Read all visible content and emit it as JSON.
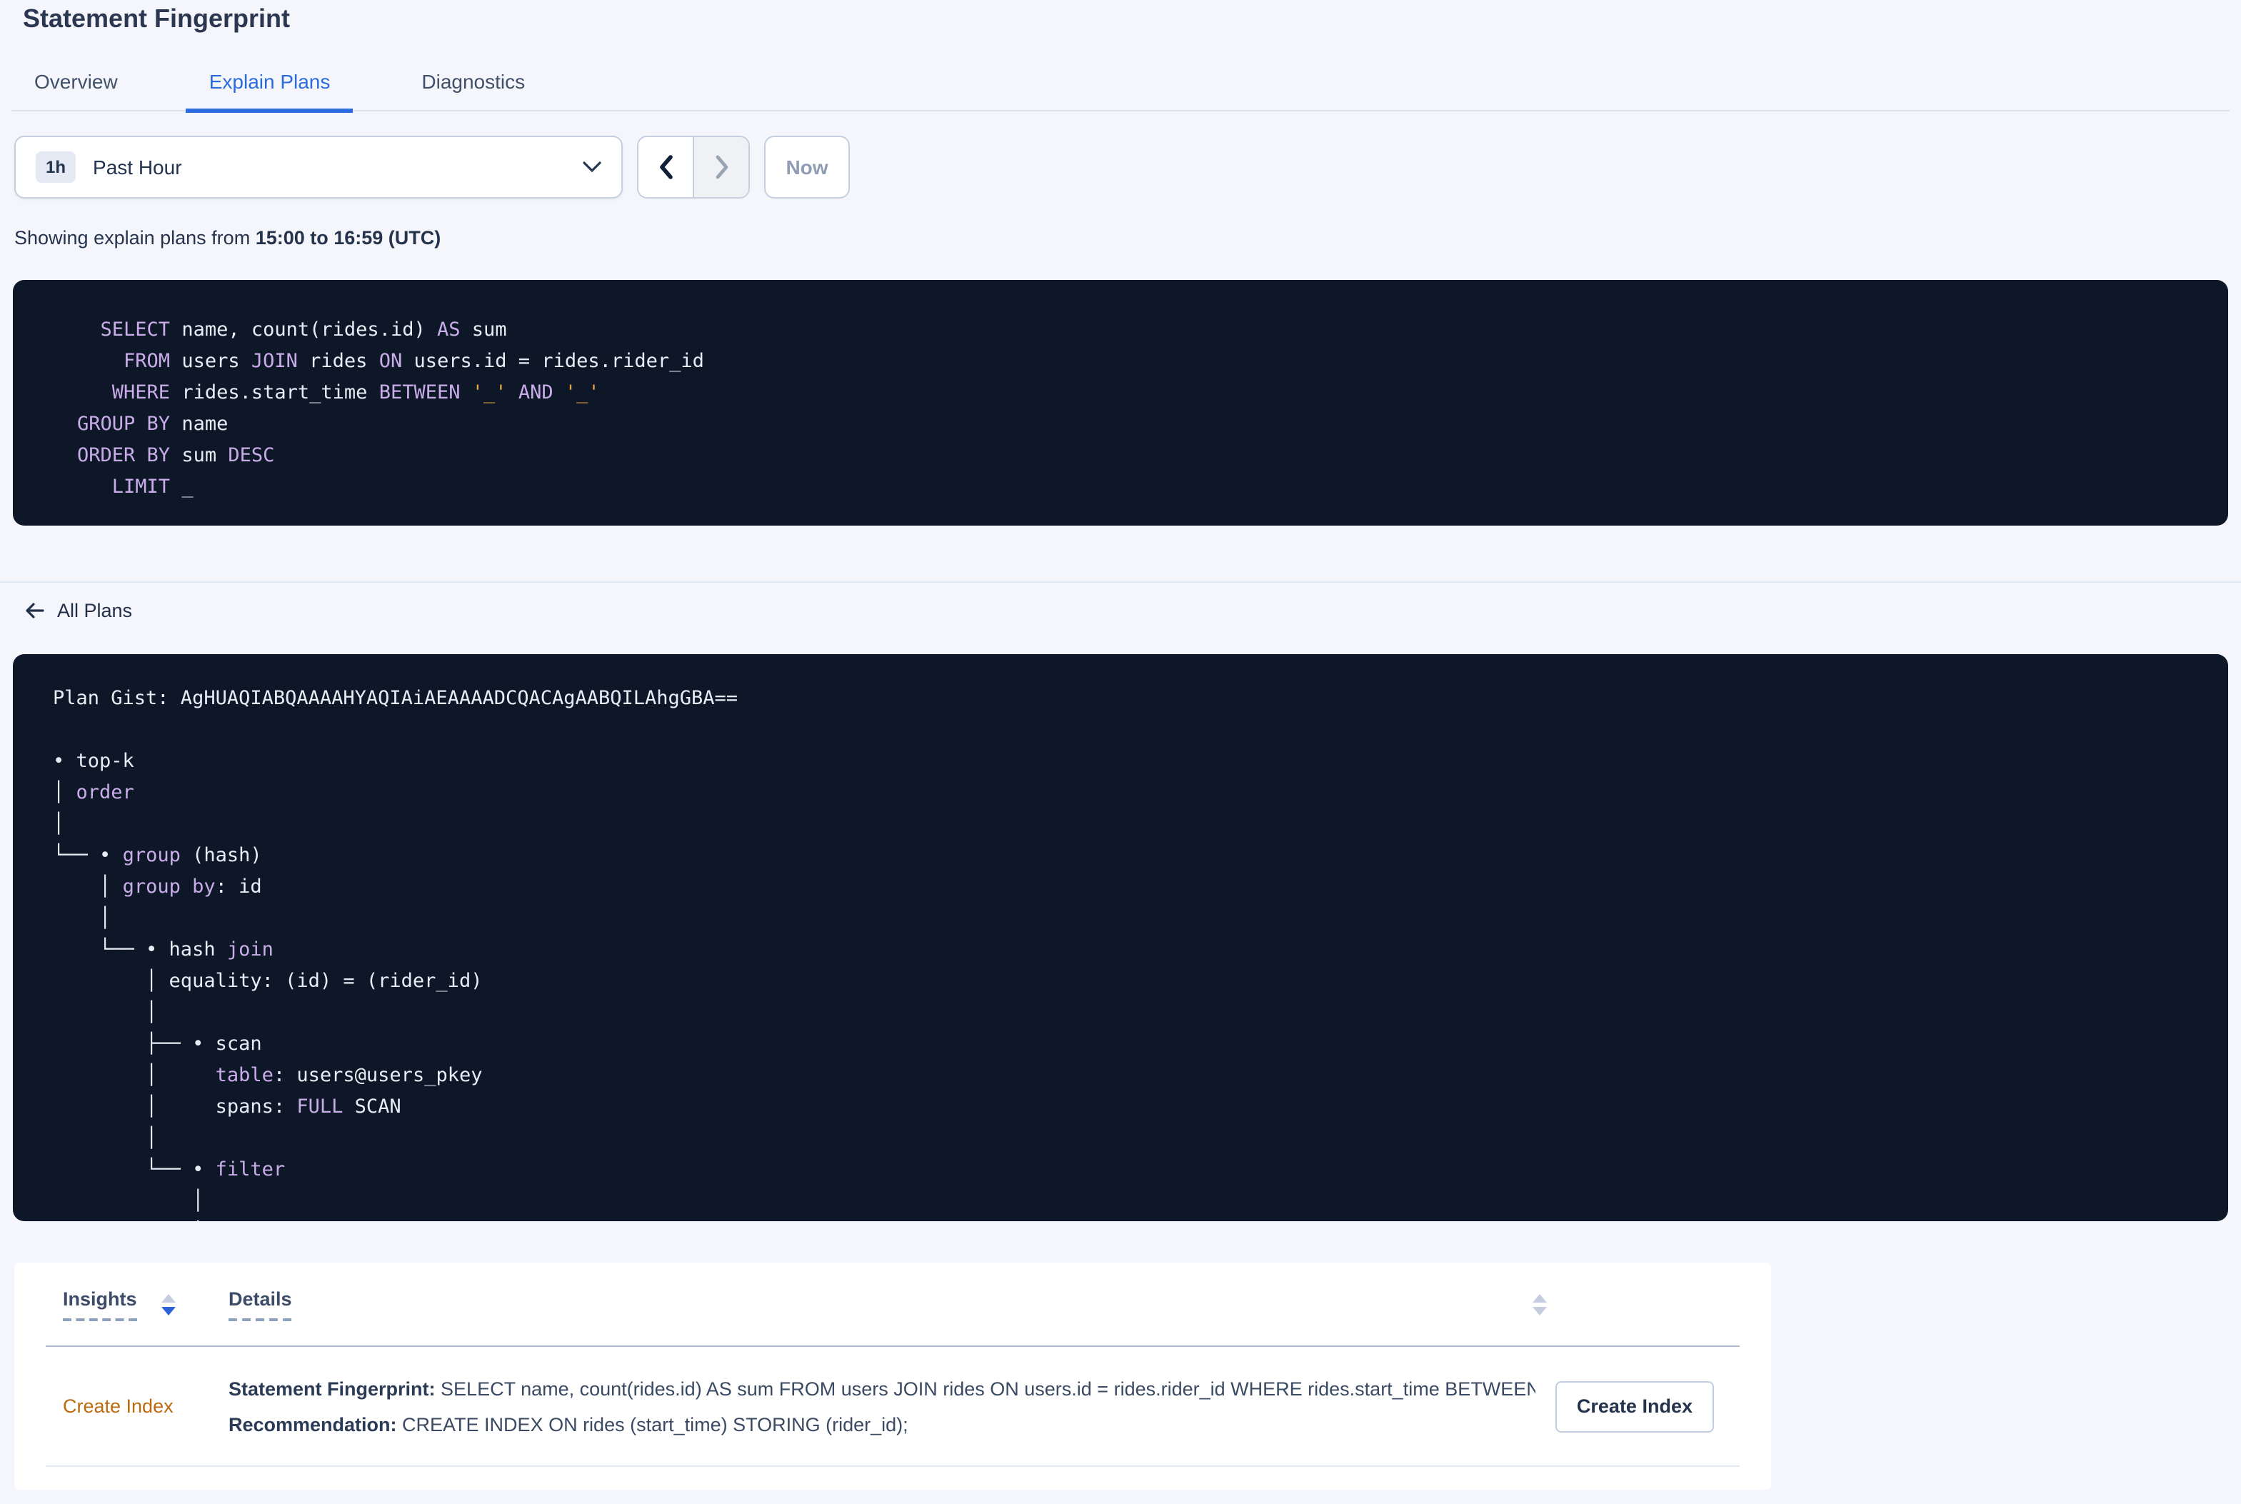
{
  "header": {
    "title": "Statement Fingerprint"
  },
  "tabs": [
    {
      "label": "Overview"
    },
    {
      "label": "Explain Plans"
    },
    {
      "label": "Diagnostics"
    }
  ],
  "time_picker": {
    "badge": "1h",
    "selected": "Past Hour",
    "now": "Now"
  },
  "subtitle": {
    "prefix": "Showing explain plans from ",
    "range": "15:00 to 16:59 (UTC)"
  },
  "sql_code": [
    [
      [
        "p",
        "  "
      ],
      [
        "k",
        "SELECT"
      ],
      [
        "p",
        " name, count(rides.id) "
      ],
      [
        "k",
        "AS"
      ],
      [
        "p",
        " sum"
      ]
    ],
    [
      [
        "p",
        "    "
      ],
      [
        "k",
        "FROM"
      ],
      [
        "p",
        " users "
      ],
      [
        "k",
        "JOIN"
      ],
      [
        "p",
        " rides "
      ],
      [
        "k",
        "ON"
      ],
      [
        "p",
        " users.id = rides.rider_id"
      ]
    ],
    [
      [
        "p",
        "   "
      ],
      [
        "k",
        "WHERE"
      ],
      [
        "p",
        " rides.start_time "
      ],
      [
        "k",
        "BETWEEN"
      ],
      [
        "p",
        " "
      ],
      [
        "l",
        "'_'"
      ],
      [
        "p",
        " "
      ],
      [
        "k",
        "AND"
      ],
      [
        "p",
        " "
      ],
      [
        "l",
        "'_'"
      ]
    ],
    [
      [
        "k",
        "GROUP BY"
      ],
      [
        "p",
        " name"
      ]
    ],
    [
      [
        "k",
        "ORDER BY"
      ],
      [
        "p",
        " sum "
      ],
      [
        "k",
        "DESC"
      ]
    ],
    [
      [
        "p",
        "   "
      ],
      [
        "k",
        "LIMIT"
      ],
      [
        "p",
        " _"
      ]
    ]
  ],
  "plans_nav": {
    "back_label": "All Plans"
  },
  "plan_code": [
    [
      [
        "p",
        "Plan Gist: AgHUAQIABQAAAAHYAQIAiAEAAAADCQACAgAABQILAhgGBA=="
      ]
    ],
    [],
    [
      [
        "p",
        "• top-k"
      ]
    ],
    [
      [
        "p",
        "│ "
      ],
      [
        "k",
        "order"
      ]
    ],
    [
      [
        "p",
        "│"
      ]
    ],
    [
      [
        "p",
        "└── • "
      ],
      [
        "k",
        "group"
      ],
      [
        "p",
        " (hash)"
      ]
    ],
    [
      [
        "p",
        "    │ "
      ],
      [
        "k",
        "group by"
      ],
      [
        "p",
        ": id"
      ]
    ],
    [
      [
        "p",
        "    │"
      ]
    ],
    [
      [
        "p",
        "    └── • hash "
      ],
      [
        "k",
        "join"
      ]
    ],
    [
      [
        "p",
        "        │ equality: (id) = (rider_id)"
      ]
    ],
    [
      [
        "p",
        "        │"
      ]
    ],
    [
      [
        "p",
        "        ├── • scan"
      ]
    ],
    [
      [
        "p",
        "        │     "
      ],
      [
        "k",
        "table"
      ],
      [
        "p",
        ": users@users_pkey"
      ]
    ],
    [
      [
        "p",
        "        │     spans: "
      ],
      [
        "k",
        "FULL"
      ],
      [
        "p",
        " SCAN"
      ]
    ],
    [
      [
        "p",
        "        │"
      ]
    ],
    [
      [
        "p",
        "        └── • "
      ],
      [
        "k",
        "filter"
      ]
    ],
    [
      [
        "p",
        "            │"
      ]
    ],
    [
      [
        "p",
        "            │"
      ]
    ]
  ],
  "insights": {
    "col_insights": "Insights",
    "col_details": "Details",
    "rows": [
      {
        "insight": "Create Index",
        "fingerprint_label": "Statement Fingerprint:",
        "fingerprint_text": " SELECT name, count(rides.id) AS sum FROM users JOIN rides ON users.id = rides.rider_id WHERE rides.start_time BETWEEN '_…",
        "recommendation_label": "Recommendation:",
        "recommendation_text": " CREATE INDEX ON rides (start_time) STORING (rider_id);",
        "action": "Create Index"
      }
    ]
  },
  "colors": {
    "accent_blue": "#2b6be0",
    "code_background": "#0e1728",
    "code_keyword": "#c9ade9",
    "code_literal": "#eda343",
    "insight_orange": "#bc6a0e"
  }
}
